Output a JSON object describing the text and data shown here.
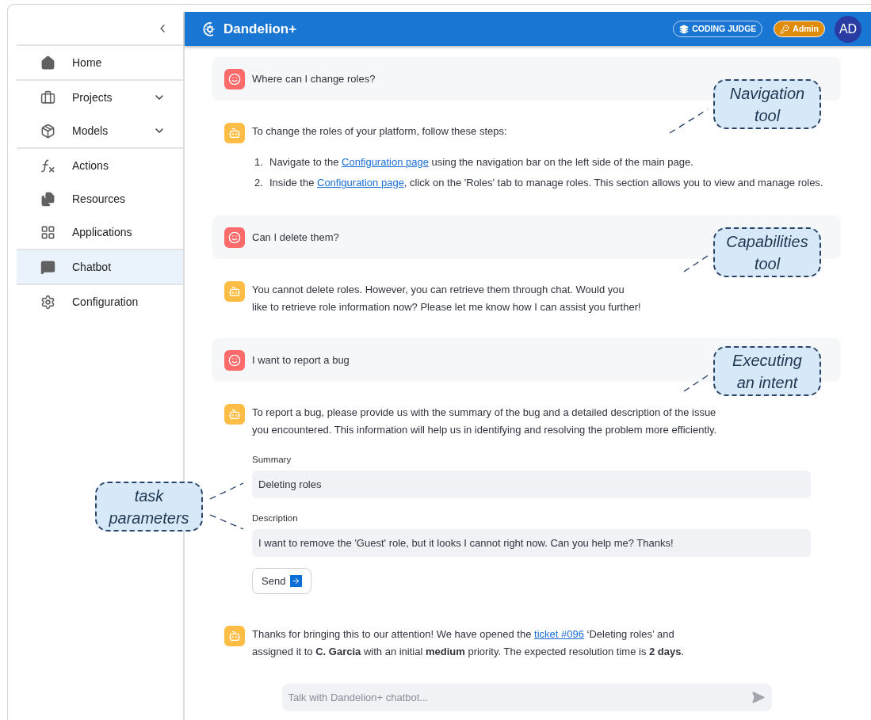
{
  "sidebar": {
    "groups": [
      [
        {
          "label": "Home",
          "selected": false,
          "expandable": false
        }
      ],
      [
        {
          "label": "Projects",
          "selected": false,
          "expandable": true
        },
        {
          "label": "Models",
          "selected": false,
          "expandable": true
        }
      ],
      [
        {
          "label": "Actions",
          "selected": false,
          "expandable": false
        },
        {
          "label": "Resources",
          "selected": false,
          "expandable": false
        },
        {
          "label": "Applications",
          "selected": false,
          "expandable": false
        }
      ],
      [
        {
          "label": "Chatbot",
          "selected": true,
          "expandable": false
        }
      ],
      [
        {
          "label": "Configuration",
          "selected": false,
          "expandable": false
        }
      ]
    ]
  },
  "header": {
    "title": "Dandelion+",
    "badges": [
      {
        "kind": "outline",
        "label": "CODING JUDGE"
      },
      {
        "kind": "filled",
        "label": "Admin"
      }
    ],
    "avatar": "AD"
  },
  "messages": [
    {
      "kind": "user",
      "lines": [
        [
          {
            "text": "Where can I change roles?"
          }
        ]
      ]
    },
    {
      "kind": "bot",
      "lines": [
        [
          {
            "text": "To change the roles of your platform, follow these steps:"
          }
        ]
      ],
      "steps": [
        {
          "number": "1.",
          "segments": [
            {
              "text": "Navigate to the "
            },
            {
              "link": "Configuration page"
            },
            {
              "text": " using the navigation bar on the left side of the main page."
            }
          ]
        },
        {
          "number": "2.",
          "segments": [
            {
              "text": "Inside the "
            },
            {
              "link": "Configuration page"
            },
            {
              "text": ", click on the 'Roles' tab to manage roles. This section allows you to view and manage roles."
            }
          ]
        }
      ]
    },
    {
      "kind": "user",
      "lines": [
        [
          {
            "text": "Can I delete them?"
          }
        ]
      ]
    },
    {
      "kind": "bot",
      "lines": [
        [
          {
            "text": "You cannot delete roles. However, you can retrieve them through chat. Would you"
          }
        ],
        [
          {
            "text": "like to retrieve role information now? Please let me know how I can assist you further!"
          }
        ]
      ]
    },
    {
      "kind": "user",
      "lines": [
        [
          {
            "text": "I want to report a bug"
          }
        ]
      ]
    },
    {
      "kind": "bot",
      "lines": [
        [
          {
            "text": "To report a bug, please provide us with the summary of the bug and a detailed description of the issue"
          }
        ],
        [
          {
            "text": "you encountered. This information will help us in identifying and resolving the problem more efficiently."
          }
        ]
      ],
      "form": {
        "fields": [
          {
            "label": "Summary",
            "value": "Deleting roles"
          },
          {
            "label": "Description",
            "value": "I want to remove the 'Guest' role, but it looks I cannot right now. Can you help me? Thanks!"
          }
        ],
        "button": "Send"
      }
    },
    {
      "kind": "bot",
      "lines": [
        [
          {
            "text": "Thanks for bringing this to our attention! We have opened the "
          },
          {
            "link": "ticket #096"
          },
          {
            "text": " ‘Deleting roles’ and"
          }
        ],
        [
          {
            "text": "assigned it to **C. Garcia** with an initial **medium** priority. The expected resolution time is **2 days**."
          }
        ]
      ]
    }
  ],
  "chat_input": {
    "placeholder": "Talk with Dandelion+ chatbot..."
  },
  "annotations": [
    {
      "lines": [
        "Navigation",
        "tool"
      ]
    },
    {
      "lines": [
        "Capabilities",
        "tool"
      ]
    },
    {
      "lines": [
        "Executing",
        "an intent"
      ]
    },
    {
      "lines": [
        "task",
        "parameters"
      ]
    }
  ]
}
